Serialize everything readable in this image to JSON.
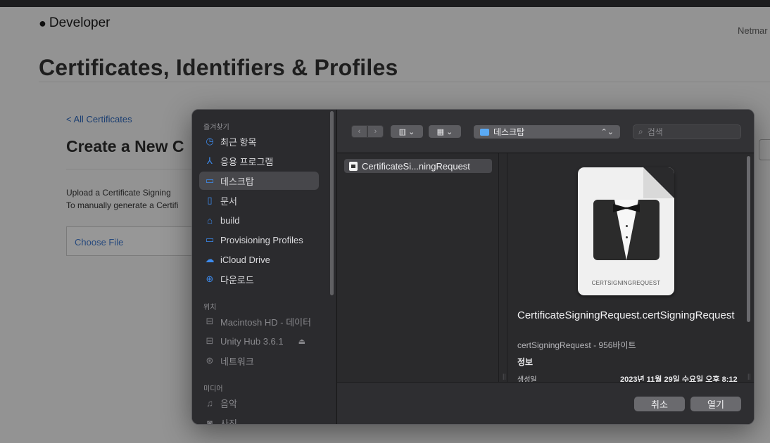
{
  "web": {
    "brand": "Developer",
    "account_text": "Netmar",
    "page_title": "Certificates, Identifiers & Profiles",
    "back_link": "< All Certificates",
    "section_title": "Create a New C",
    "upload_line1": "Upload a Certificate Signing",
    "upload_line2": "To manually generate a Certifi",
    "choose_file": "Choose File"
  },
  "sidebar": {
    "favorites_title": "즐겨찾기",
    "favorites": [
      {
        "label": "최근 항목",
        "icon": "clock-icon"
      },
      {
        "label": "응용 프로그램",
        "icon": "applications-icon"
      },
      {
        "label": "데스크탑",
        "icon": "desktop-icon",
        "selected": true
      },
      {
        "label": "문서",
        "icon": "document-icon"
      },
      {
        "label": "build",
        "icon": "home-icon"
      },
      {
        "label": "Provisioning Profiles",
        "icon": "folder-icon"
      },
      {
        "label": "iCloud Drive",
        "icon": "cloud-icon"
      },
      {
        "label": "다운로드",
        "icon": "download-icon"
      }
    ],
    "locations_title": "위치",
    "locations": [
      {
        "label": "Macintosh HD - 데이터",
        "icon": "disk-icon"
      },
      {
        "label": "Unity Hub 3.6.1",
        "icon": "disk-icon"
      },
      {
        "label": "네트워크",
        "icon": "network-icon"
      }
    ],
    "media_title": "미디어",
    "media": [
      {
        "label": "음악",
        "icon": "music-icon"
      },
      {
        "label": "사진",
        "icon": "camera-icon"
      }
    ]
  },
  "toolbar": {
    "back_glyph": "‹",
    "forward_glyph": "›",
    "column_view_glyph": "▥ ⌄",
    "gallery_view_glyph": "▦ ⌄",
    "path_label": "데스크탑",
    "search_placeholder": "검색"
  },
  "file_list": [
    {
      "name": "CertificateSi...ningRequest"
    }
  ],
  "preview": {
    "doc_badge": "CERTSIGNINGREQUEST",
    "file_name": "CertificateSigningRequest.certSigningRequest",
    "file_type": "certSigningRequest - 956바이트",
    "info_title": "정보",
    "created_label": "생성일",
    "created_value": "2023년 11월 29일 수요일 오후 8:12"
  },
  "buttons": {
    "cancel": "취소",
    "open": "열기"
  },
  "colors": {
    "accent": "#3d8cf0",
    "folder": "#5aaaf5"
  }
}
